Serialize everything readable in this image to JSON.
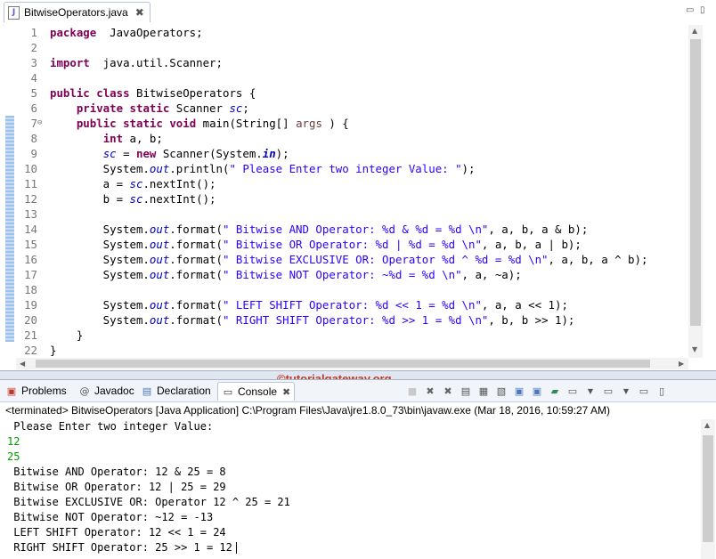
{
  "editor": {
    "tab_title": "BitwiseOperators.java",
    "tab_close": "✖",
    "minimize": "▭",
    "maximize": "▯"
  },
  "code_lines": [
    {
      "n": "1",
      "t": [
        [
          "kw",
          "package"
        ],
        [
          "",
          "  JavaOperators;"
        ]
      ]
    },
    {
      "n": "2",
      "t": []
    },
    {
      "n": "3",
      "t": [
        [
          "kw",
          "import"
        ],
        [
          "",
          "  java.util.Scanner;"
        ]
      ]
    },
    {
      "n": "4",
      "t": []
    },
    {
      "n": "5",
      "t": [
        [
          "kw",
          "public"
        ],
        [
          "",
          " "
        ],
        [
          "kw",
          "class"
        ],
        [
          "",
          " BitwiseOperators {"
        ]
      ]
    },
    {
      "n": "6",
      "t": [
        [
          "",
          "    "
        ],
        [
          "kw",
          "private"
        ],
        [
          "",
          " "
        ],
        [
          "kw",
          "static"
        ],
        [
          "",
          " Scanner "
        ],
        [
          "fld",
          "sc"
        ],
        [
          "",
          ";"
        ]
      ]
    },
    {
      "n": "7",
      "fold": "⊖",
      "t": [
        [
          "",
          "    "
        ],
        [
          "kw",
          "public"
        ],
        [
          "",
          " "
        ],
        [
          "kw",
          "static"
        ],
        [
          "",
          " "
        ],
        [
          "kw",
          "void"
        ],
        [
          "",
          " main(String[] "
        ],
        [
          "param",
          "args"
        ],
        [
          "",
          " ) {"
        ]
      ]
    },
    {
      "n": "8",
      "t": [
        [
          "",
          "        "
        ],
        [
          "kw",
          "int"
        ],
        [
          "",
          " a, b;"
        ]
      ]
    },
    {
      "n": "9",
      "t": [
        [
          "",
          "        "
        ],
        [
          "fld",
          "sc"
        ],
        [
          "",
          " = "
        ],
        [
          "kw",
          "new"
        ],
        [
          "",
          " Scanner(System."
        ],
        [
          "stf",
          "in"
        ],
        [
          "",
          ");"
        ]
      ]
    },
    {
      "n": "10",
      "t": [
        [
          "",
          "        System."
        ],
        [
          "fld",
          "out"
        ],
        [
          "",
          ".println("
        ],
        [
          "str",
          "\" Please Enter two integer Value: \""
        ],
        [
          "",
          ");"
        ]
      ]
    },
    {
      "n": "11",
      "t": [
        [
          "",
          "        a = "
        ],
        [
          "fld",
          "sc"
        ],
        [
          "",
          ".nextInt();"
        ]
      ]
    },
    {
      "n": "12",
      "t": [
        [
          "",
          "        b = "
        ],
        [
          "fld",
          "sc"
        ],
        [
          "",
          ".nextInt();"
        ]
      ]
    },
    {
      "n": "13",
      "t": []
    },
    {
      "n": "14",
      "t": [
        [
          "",
          "        System."
        ],
        [
          "fld",
          "out"
        ],
        [
          "",
          ".format("
        ],
        [
          "str",
          "\" Bitwise AND Operator: %d & %d = %d \\n\""
        ],
        [
          "",
          ", a, b, a & b);"
        ]
      ]
    },
    {
      "n": "15",
      "t": [
        [
          "",
          "        System."
        ],
        [
          "fld",
          "out"
        ],
        [
          "",
          ".format("
        ],
        [
          "str",
          "\" Bitwise OR Operator: %d | %d = %d \\n\""
        ],
        [
          "",
          ", a, b, a | b);"
        ]
      ]
    },
    {
      "n": "16",
      "t": [
        [
          "",
          "        System."
        ],
        [
          "fld",
          "out"
        ],
        [
          "",
          ".format("
        ],
        [
          "str",
          "\" Bitwise EXCLUSIVE OR: Operator %d ^ %d = %d \\n\""
        ],
        [
          "",
          ", a, b, a ^ b);"
        ]
      ]
    },
    {
      "n": "17",
      "t": [
        [
          "",
          "        System."
        ],
        [
          "fld",
          "out"
        ],
        [
          "",
          ".format("
        ],
        [
          "str",
          "\" Bitwise NOT Operator: ~%d = %d \\n\""
        ],
        [
          "",
          ", a, ~a);"
        ]
      ]
    },
    {
      "n": "18",
      "t": []
    },
    {
      "n": "19",
      "t": [
        [
          "",
          "        System."
        ],
        [
          "fld",
          "out"
        ],
        [
          "",
          ".format("
        ],
        [
          "str",
          "\" LEFT SHIFT Operator: %d << 1 = %d \\n\""
        ],
        [
          "",
          ", a, a << 1);"
        ]
      ]
    },
    {
      "n": "20",
      "t": [
        [
          "",
          "        System."
        ],
        [
          "fld",
          "out"
        ],
        [
          "",
          ".format("
        ],
        [
          "str",
          "\" RIGHT SHIFT Operator: %d >> 1 = %d \\n\""
        ],
        [
          "",
          ", b, b >> 1);"
        ]
      ]
    },
    {
      "n": "21",
      "t": [
        [
          "",
          "    }"
        ]
      ]
    },
    {
      "n": "22",
      "t": [
        [
          "",
          "}"
        ]
      ]
    }
  ],
  "views": {
    "problems": "Problems",
    "javadoc": "Javadoc",
    "declaration": "Declaration",
    "console": "Console",
    "console_close": "✖"
  },
  "watermark": "©tutorialgateway.org",
  "console": {
    "status": "<terminated> BitwiseOperators [Java Application] C:\\Program Files\\Java\\jre1.8.0_73\\bin\\javaw.exe (Mar 18, 2016, 10:59:27 AM)",
    "lines": [
      {
        "cls": "",
        "text": " Please Enter two integer Value:"
      },
      {
        "cls": "inp",
        "text": "12"
      },
      {
        "cls": "inp",
        "text": "25"
      },
      {
        "cls": "",
        "text": " Bitwise AND Operator: 12 & 25 = 8"
      },
      {
        "cls": "",
        "text": " Bitwise OR Operator: 12 | 25 = 29"
      },
      {
        "cls": "",
        "text": " Bitwise EXCLUSIVE OR: Operator 12 ^ 25 = 21"
      },
      {
        "cls": "",
        "text": " Bitwise NOT Operator: ~12 = -13"
      },
      {
        "cls": "",
        "text": " LEFT SHIFT Operator: 12 << 1 = 24"
      },
      {
        "cls": "",
        "text": " RIGHT SHIFT Operator: 25 >> 1 = 12"
      }
    ]
  },
  "colors": {
    "keyword": "#7f0055",
    "string": "#2a00ff",
    "field": "#0000c0",
    "stdin": "#00a000",
    "watermark": "#c0392b"
  }
}
